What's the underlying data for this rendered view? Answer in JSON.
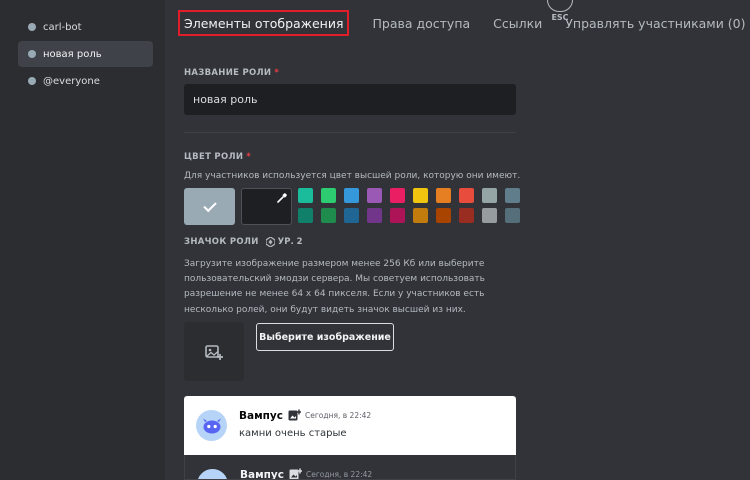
{
  "sidebar": {
    "roles": [
      {
        "label": "carl-bot"
      },
      {
        "label": "новая роль"
      },
      {
        "label": "@everyone"
      }
    ]
  },
  "tabs": [
    {
      "label": "Элементы отображения"
    },
    {
      "label": "Права доступа"
    },
    {
      "label": "Ссылки"
    },
    {
      "label": "Управлять участниками (0)"
    }
  ],
  "esc_label": "ESC",
  "role_name": {
    "label": "НАЗВАНИЕ РОЛИ",
    "required_mark": "*",
    "value": "новая роль"
  },
  "role_color": {
    "label": "ЦВЕТ РОЛИ",
    "required_mark": "*",
    "hint": "Для участников используется цвет высшей роли, которую они имеют.",
    "default_color": "#99aab5",
    "swatches": [
      "#1abc9c",
      "#2ecc71",
      "#3498db",
      "#9b59b6",
      "#e91e63",
      "#f1c40f",
      "#e67e22",
      "#e74c3c",
      "#95a5a6",
      "#607d8b",
      "#11806a",
      "#1f8b4c",
      "#206694",
      "#71368a",
      "#ad1457",
      "#c27c0e",
      "#a84300",
      "#992d22",
      "#979c9f",
      "#546e7a"
    ]
  },
  "role_icon": {
    "label": "ЗНАЧОК РОЛИ",
    "level": "УР. 2",
    "hint": [
      "Загрузите изображение размером менее 256 Кб или выберите",
      "пользовательский эмодзи сервера. Мы советуем использовать",
      "разрешение не менее 64 x 64 пикселя. Если у участников есть",
      "несколько ролей, они будут видеть значок высшей из них."
    ],
    "choose_button": "Выберите изображение"
  },
  "preview": {
    "light": {
      "username": "Вампус",
      "time": "Сегодня, в 22:42",
      "text": "камни очень старые"
    },
    "dark": {
      "username": "Вампус",
      "time": "Сегодня, в 22:42"
    }
  },
  "colors": {
    "highlight_border": "#e11d2a",
    "required": "#f23f43"
  }
}
